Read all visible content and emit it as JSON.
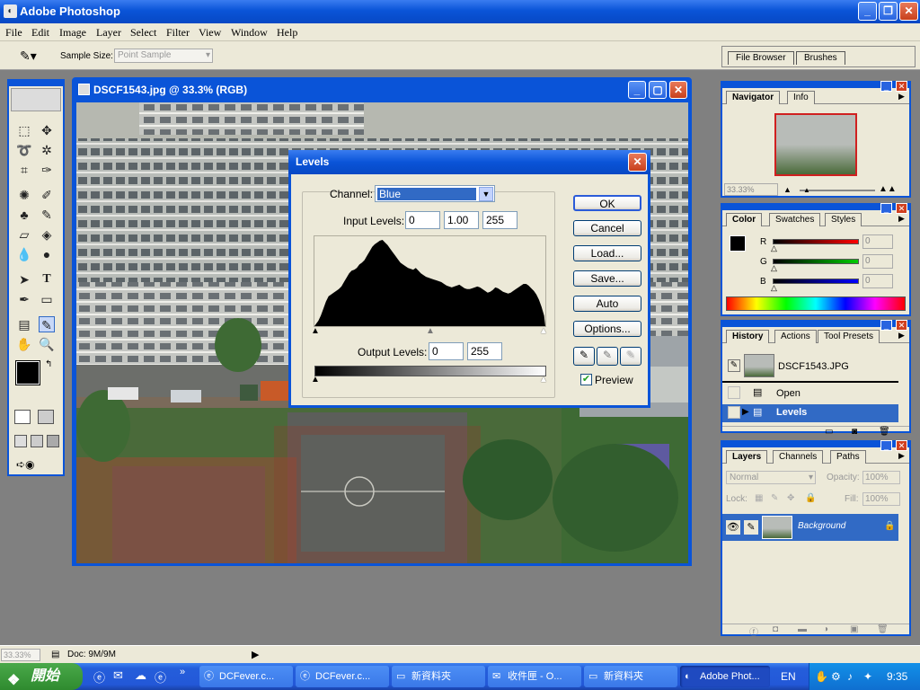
{
  "app": {
    "title": "Adobe Photoshop",
    "logo": "ps-logo-icon"
  },
  "menu": [
    "File",
    "Edit",
    "Image",
    "Layer",
    "Select",
    "Filter",
    "View",
    "Window",
    "Help"
  ],
  "options_bar": {
    "sample_size_label": "Sample Size:",
    "sample_size_value": "Point Sample",
    "tabs": [
      "File Browser",
      "Brushes"
    ]
  },
  "document": {
    "title": "DSCF1543.jpg @ 33.3% (RGB)"
  },
  "levels": {
    "title": "Levels",
    "channel_label": "Channel:",
    "channel_value": "Blue",
    "input_label": "Input Levels:",
    "input_values": [
      "0",
      "1.00",
      "255"
    ],
    "output_label": "Output Levels:",
    "output_values": [
      "0",
      "255"
    ],
    "buttons": [
      "OK",
      "Cancel",
      "Load...",
      "Save...",
      "Auto",
      "Options..."
    ],
    "preview_label": "Preview",
    "preview_checked": true,
    "histogram": [
      2,
      6,
      12,
      20,
      28,
      34,
      36,
      38,
      40,
      42,
      45,
      50,
      55,
      60,
      63,
      64,
      66,
      70,
      72,
      75,
      80,
      85,
      90,
      93,
      95,
      97,
      98,
      95,
      92,
      88,
      84,
      80,
      76,
      72,
      70,
      68,
      66,
      65,
      64,
      66,
      63,
      60,
      58,
      56,
      55,
      54,
      53,
      52,
      51,
      50,
      48,
      46,
      45,
      44,
      45,
      46,
      47,
      45,
      43,
      42,
      42,
      43,
      44,
      45,
      44,
      42,
      40,
      38,
      39,
      41,
      44,
      43,
      41,
      39,
      38,
      37,
      38,
      40,
      42,
      44,
      46,
      48,
      48,
      46,
      43,
      40,
      36,
      30,
      22,
      12
    ]
  },
  "navigator": {
    "tabs": [
      "Navigator",
      "Info"
    ],
    "zoom": "33.33%"
  },
  "color": {
    "tabs": [
      "Color",
      "Swatches",
      "Styles"
    ],
    "channels": [
      {
        "label": "R",
        "value": "0"
      },
      {
        "label": "G",
        "value": "0"
      },
      {
        "label": "B",
        "value": "0"
      }
    ]
  },
  "history": {
    "tabs": [
      "History",
      "Actions",
      "Tool Presets"
    ],
    "snapshot": "DSCF1543.JPG",
    "items": [
      {
        "label": "Open",
        "selected": false
      },
      {
        "label": "Levels",
        "selected": true
      }
    ]
  },
  "layers": {
    "tabs": [
      "Layers",
      "Channels",
      "Paths"
    ],
    "mode": "Normal",
    "opacity_label": "Opacity:",
    "opacity": "100%",
    "lock_label": "Lock:",
    "fill_label": "Fill:",
    "fill": "100%",
    "layer_name": "Background"
  },
  "status": {
    "zoom": "33.33%",
    "doc": "Doc: 9M/9M"
  },
  "taskbar": {
    "start": "開始",
    "tasks": [
      "DCFever.c...",
      "DCFever.c...",
      "新資料夾",
      "收件匣 - O...",
      "新資料夾",
      "Adobe Phot..."
    ],
    "lang": "EN",
    "time": "9:35"
  },
  "colors": {
    "xp_blue": "#0a54d8",
    "dialog_bg": "#ece9d8",
    "selection": "#316ac5"
  }
}
